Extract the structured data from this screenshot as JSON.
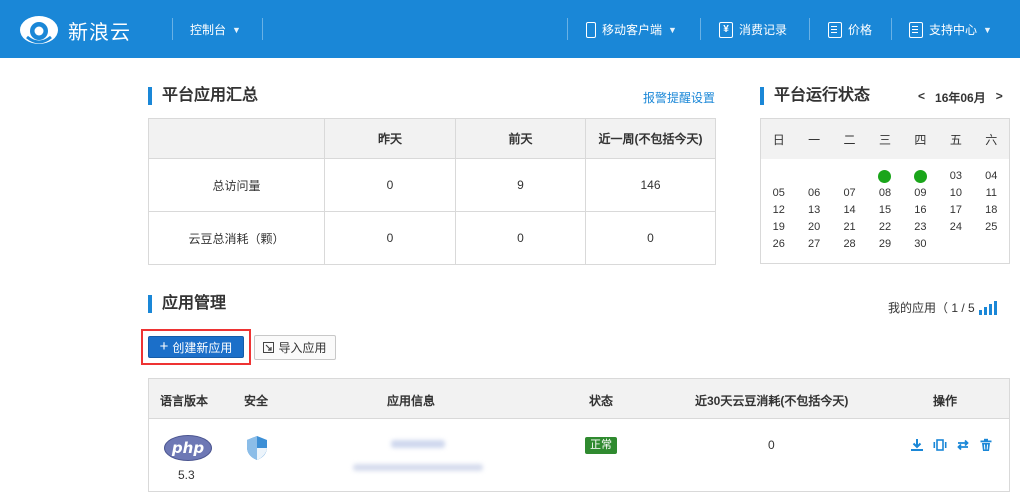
{
  "header": {
    "brand": "新浪云",
    "console": "控制台",
    "mobile_client": "移动客户端",
    "billing": "消费记录",
    "price": "价格",
    "support": "支持中心"
  },
  "summary": {
    "title": "平台应用汇总",
    "settings_link": "报警提醒设置",
    "columns": [
      "",
      "昨天",
      "前天",
      "近一周(不包括今天)"
    ],
    "rows": [
      {
        "label": "总访问量",
        "values": [
          "0",
          "9",
          "146"
        ]
      },
      {
        "label": "云豆总消耗（颗）",
        "values": [
          "0",
          "0",
          "0"
        ]
      }
    ]
  },
  "calendar": {
    "title": "平台运行状态",
    "prev": "<",
    "month": "16年06月",
    "next": ">",
    "weekdays": [
      "日",
      "一",
      "二",
      "三",
      "四",
      "五",
      "六"
    ],
    "days": [
      "",
      "",
      "",
      "dot",
      "dot",
      "03",
      "04",
      "05",
      "06",
      "07",
      "08",
      "09",
      "10",
      "11",
      "12",
      "13",
      "14",
      "15",
      "16",
      "17",
      "18",
      "19",
      "20",
      "21",
      "22",
      "23",
      "24",
      "25",
      "26",
      "27",
      "28",
      "29",
      "30",
      "",
      ""
    ],
    "status_color": "#1aa51a"
  },
  "apps": {
    "title": "应用管理",
    "my_apps": "我的应用（ 1 / 5",
    "create_button": "创建新应用",
    "import_button": "导入应用",
    "columns": [
      "语言版本",
      "安全",
      "应用信息",
      "状态",
      "近30天云豆消耗(不包括今天)",
      "操作"
    ],
    "row": {
      "language": "php",
      "version": "5.3",
      "status": "正常",
      "consumption": "0"
    }
  },
  "colors": {
    "brand": "#1a87d7",
    "highlight": "#e33333"
  }
}
